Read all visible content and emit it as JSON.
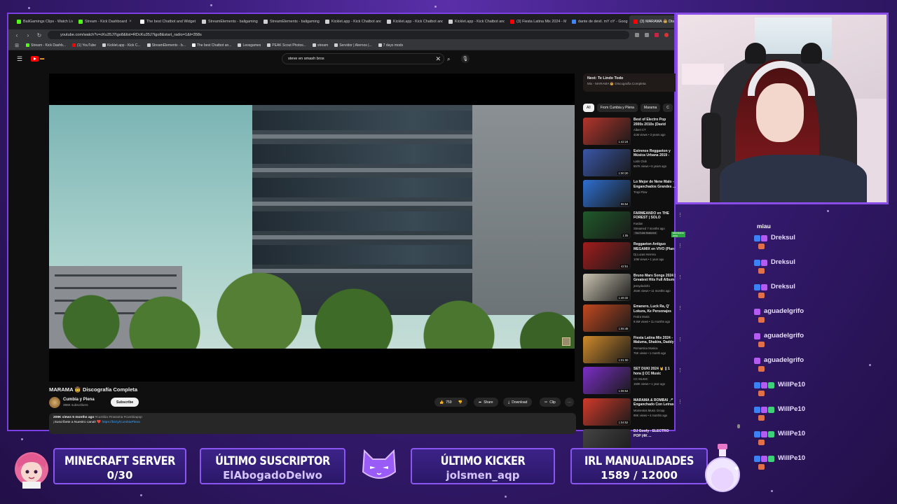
{
  "browser": {
    "tabs": [
      {
        "label": "BaliGamings Clips - Watch Liv",
        "color": "#53fc18",
        "active": false
      },
      {
        "label": "Stream - Kick Dashboard",
        "color": "#53fc18",
        "active": false
      },
      {
        "label": "The best Chatbot and Widget",
        "color": "#ffffff",
        "active": false
      },
      {
        "label": "StreamElements - baligaming",
        "color": "#cfcfcf",
        "active": false
      },
      {
        "label": "StreamElements - baligaming",
        "color": "#cfcfcf",
        "active": false
      },
      {
        "label": "Kicklet.app - Kick Chatbot and",
        "color": "#cfcfcf",
        "active": false
      },
      {
        "label": "Kicklet.app - Kick Chatbot and",
        "color": "#cfcfcf",
        "active": false
      },
      {
        "label": "Kicklet.app - Kick Chatbot and",
        "color": "#cfcfcf",
        "active": false
      },
      {
        "label": "(3) Fiesta Latina Mix 2024 - Mi",
        "color": "#ff0000",
        "active": false
      },
      {
        "label": "dante de devil. mY oY - Goog",
        "color": "#4285f4",
        "active": false
      },
      {
        "label": "(3) MARAMA 🤠 Disc",
        "color": "#ff0000",
        "active": true
      }
    ],
    "url": "youtube.com/watch?v=cKu35J7tgo8&list=RDcKu35J7tgo8&start_radio=1&t=358s",
    "bookmarks": [
      {
        "label": "Stream - Kick Dashb...",
        "color": "#53fc18"
      },
      {
        "label": "(1) YouTube",
        "color": "#ff0000"
      },
      {
        "label": "Kicklet.app - Kick C...",
        "color": "#cfcfcf"
      },
      {
        "label": "StreamElements - b...",
        "color": "#cfcfcf"
      },
      {
        "label": "The best Chatbot an...",
        "color": "#ffffff"
      },
      {
        "label": "Leosgames",
        "color": "#cfcfcf"
      },
      {
        "label": "PEAK Scout Photos...",
        "color": "#cfcfcf"
      },
      {
        "label": "stream",
        "color": "#cfcfcf"
      },
      {
        "label": "Servidor | Aternos |...",
        "color": "#cfcfcf"
      },
      {
        "label": "7 days mods",
        "color": "#cfcfcf"
      }
    ]
  },
  "youtube": {
    "search_query": "steve en smash bros",
    "video": {
      "title": "MARAMA 🤠 Discografía Completa",
      "channel": "Cumbia y Plena",
      "subscribers": "398K subscribers",
      "subscribe_label": "Subscribe",
      "likes": "759",
      "share_label": "Share",
      "download_label": "Download",
      "clip_label": "Clip",
      "views_date": "209K views  5 months ago",
      "tags": "#cumbia #marama #cumbiapop",
      "desc_line": "¡Suscríbete a Nuestro canal! ❤️",
      "desc_link": "https://bit.ly/CumbiaPlena"
    },
    "up_next": {
      "title": "Next: Te Lindo Todo",
      "subtitle": "Mix - MARAMA 🤠 Discografía Completa"
    },
    "chips": [
      {
        "label": "All",
        "selected": true
      },
      {
        "label": "From Cumbia y Plena",
        "selected": false
      },
      {
        "label": "Marama",
        "selected": false
      },
      {
        "label": "C",
        "selected": false
      }
    ],
    "recommendations": [
      {
        "title": "Best of Electro Pop 2000s 2010s (David Guetta, L...",
        "channel": "Albert CT",
        "views": "41M views • 3 years ago",
        "duration": "1:42:24",
        "thumb": "#b3352b"
      },
      {
        "title": "Estrenos Reggaeton y Música Urbana 2019 - Farruko, ...",
        "channel": "Latin Club",
        "views": "657K views • 6 years ago",
        "duration": "1:00:20",
        "thumb": "#3a56a8"
      },
      {
        "title": "Lo Mejor de Nene Malo - Enganchados Grandes ...",
        "channel": "Tropi Flow",
        "views": "",
        "duration": "55:54",
        "thumb": "#2e6fd1"
      },
      {
        "title": "FARMEANDO en THE FOREST | SOLO MIEMBROS",
        "channel": "Fardan",
        "views": "Streamed 7 months ago",
        "duration": "1:05",
        "thumb": "#1f5a2a",
        "badge": "YouTube featured",
        "badge2": "Members only"
      },
      {
        "title": "Reggaeton Antiguo MEGAMIX en VIVO (Plan B, Daddy y más)...",
        "channel": "Dj Lucas Herrera",
        "views": "10M views • 1 year ago",
        "duration": "42:51",
        "thumb": "#a11c1c"
      },
      {
        "title": "Bruno Mars Songs 2024 | Greatest Hits Full Album 2024 ...",
        "channel": "jessydedoh1",
        "views": "264K views • 11 months ago",
        "duration": "1:46:32",
        "thumb": "#c9c3b0"
      },
      {
        "title": "Emanero, Luck Ra, Q' Lokura, Ke Personajes Tendencia 2024 - ...",
        "channel": "Fedra Music",
        "views": "9.5M views • 11 months ago",
        "duration": "1:55:48",
        "thumb": "#c2481f"
      },
      {
        "title": "Fiesta Latina Mix 2024 - Maluma, Shakira, Daddy ...",
        "channel": "Romantica Musica",
        "views": "75K views • 1 month ago",
        "duration": "1:01:00",
        "thumb": "#d08a2a"
      },
      {
        "title": "SET DUKI 2024 🤘 || 1 hora || CC Music",
        "channel": "CC MUSIC",
        "views": "150K views • 1 year ago",
        "duration": "1:06:54",
        "thumb": "#7b2ec7"
      },
      {
        "title": "MARAMA & ROMBAI 🎤 Enganchado Con Letras 🤠 ...",
        "channel": "Momentos Music Group",
        "views": "95K views • 4 months ago",
        "duration": "1:04:52",
        "thumb": "#d23a2a"
      },
      {
        "title": "DJ Goofy - ELECTRO POP (4K ...",
        "channel": "",
        "views": "",
        "duration": "",
        "thumb": "#444444"
      }
    ]
  },
  "chat": {
    "first_message": "miau",
    "messages": [
      {
        "name": "Dreksul",
        "badges": [
          "b",
          "p"
        ]
      },
      {
        "name": "Dreksul",
        "badges": [
          "b",
          "p"
        ]
      },
      {
        "name": "Dreksul",
        "badges": [
          "b",
          "p"
        ]
      },
      {
        "name": "aguadelgrifo",
        "badges": [
          "p"
        ]
      },
      {
        "name": "aguadelgrifo",
        "badges": [
          "p"
        ]
      },
      {
        "name": "aguadelgrifo",
        "badges": [
          "p"
        ]
      },
      {
        "name": "WillPe10",
        "badges": [
          "b",
          "p",
          "g"
        ]
      },
      {
        "name": "WillPe10",
        "badges": [
          "b",
          "p",
          "g"
        ]
      },
      {
        "name": "WillPe10",
        "badges": [
          "b",
          "p",
          "g"
        ]
      },
      {
        "name": "WillPe10",
        "badges": [
          "b",
          "p",
          "g"
        ]
      }
    ]
  },
  "overlay": {
    "minecraft": {
      "title": "MINECRAFT SERVER",
      "value": "0/30"
    },
    "suscriptor": {
      "title": "ÚLTIMO SUSCRIPTOR",
      "value": "ElAbogadoDelwo"
    },
    "kicker": {
      "title": "ÚLTIMO KICKER",
      "value": "jolsmen_aqp"
    },
    "manualidades": {
      "title": "IRL MANUALIDADES",
      "value": "1589 / 12000"
    },
    "colors": {
      "accent": "#8a55f0",
      "panel": "#3c2388"
    }
  }
}
